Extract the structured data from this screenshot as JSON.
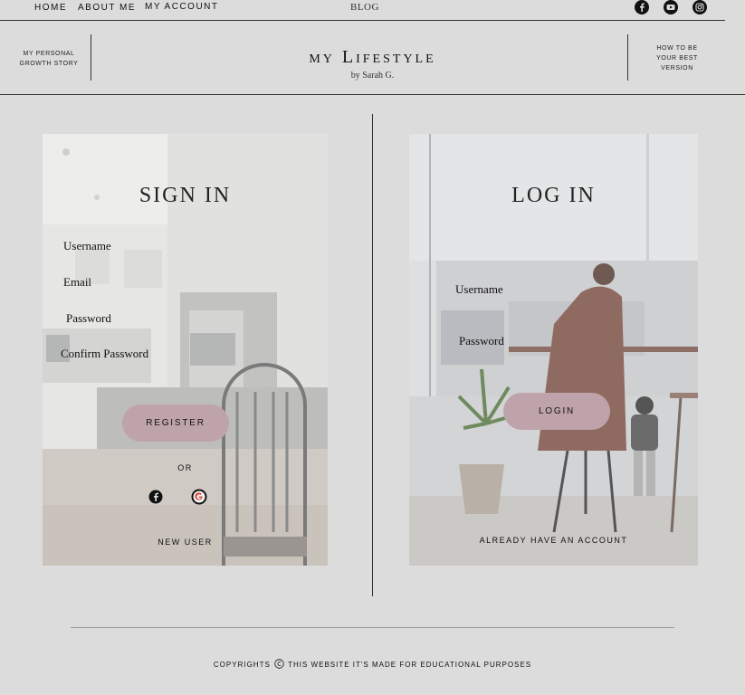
{
  "nav": {
    "home": "Home",
    "about": "About me",
    "account": "My account",
    "blog": "Blog"
  },
  "social_icons": [
    "facebook-icon",
    "youtube-icon",
    "instagram-icon"
  ],
  "header": {
    "left_line1": "my personal",
    "left_line2": "growth story",
    "title": "my Lifestyle",
    "subtitle": "by Sarah G.",
    "right_line1": "How to be",
    "right_line2": "your best",
    "right_line3": "version"
  },
  "signin": {
    "title": "SIGN IN",
    "username": "Username",
    "email": "Email",
    "password": "Password",
    "confirm_password": "Confirm Password",
    "register": "Register",
    "or": "or",
    "new_user": "new user"
  },
  "login": {
    "title": "LOG IN",
    "username": "Username",
    "password": "Password",
    "login_button": "login",
    "already": "already have an account"
  },
  "footer": {
    "text": "Copyrights",
    "text2": "This website it's made for educational purposes"
  },
  "colors": {
    "background": "#dcdcdc",
    "accent_pill": "#bfa3aa",
    "line": "#333333"
  }
}
